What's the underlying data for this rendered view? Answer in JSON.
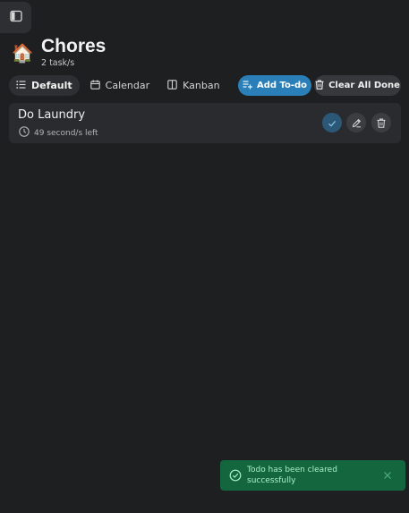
{
  "header": {
    "emoji": "🏠",
    "title": "Chores",
    "task_count": "2 task/s"
  },
  "tabs": [
    {
      "label": "Default",
      "icon": "list-icon",
      "active": true
    },
    {
      "label": "Calendar",
      "icon": "calendar-icon",
      "active": false
    },
    {
      "label": "Kanban",
      "icon": "kanban-icon",
      "active": false
    }
  ],
  "toolbar": {
    "add_label": "Add To-do",
    "clear_label": "Clear All Done"
  },
  "tasks": [
    {
      "name": "Do Laundry",
      "time_left": "49 second/s left",
      "actions": [
        "check-icon",
        "pencil-icon",
        "trash-icon"
      ]
    }
  ],
  "toast": {
    "message": "Todo has been cleared successfully",
    "icon": "check-circle-icon"
  },
  "colors": {
    "background": "#1e1f21",
    "card": "#2a2b2e",
    "accent": "#2a7fb8",
    "toast_bg": "#14663e",
    "toast_text": "#a9efc8"
  }
}
